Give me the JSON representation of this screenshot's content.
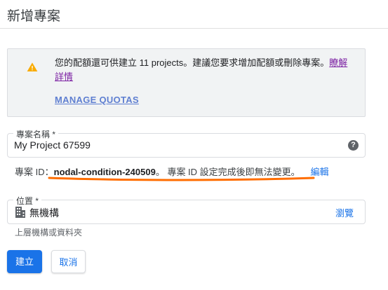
{
  "page": {
    "title": "新增專案"
  },
  "quota": {
    "message": "您的配額還可供建立 11 projects。建議您要求增加配額或刪除專案。",
    "learn_more": "瞭解詳情",
    "manage_quotas": "MANAGE QUOTAS",
    "icon": "warning-icon"
  },
  "project_name": {
    "label": "專案名稱 *",
    "value": "My Project 67599",
    "icon": "help-icon",
    "help_glyph": "?"
  },
  "project_id": {
    "prefix": "專案 ID：",
    "id": "nodal-condition-240509",
    "suffix": "。 專案 ID 設定完成後即無法變更。",
    "edit": "編輯"
  },
  "location": {
    "label": "位置 *",
    "value": "無機構",
    "browse": "瀏覽",
    "icon": "building-icon",
    "hint": "上層機構或資料夾"
  },
  "buttons": {
    "create": "建立",
    "cancel": "取消"
  },
  "colors": {
    "primary": "#1a73e8",
    "warning": "#f9ab00",
    "annotation": "#ff6d00",
    "link_visited": "#7b1fa2"
  }
}
